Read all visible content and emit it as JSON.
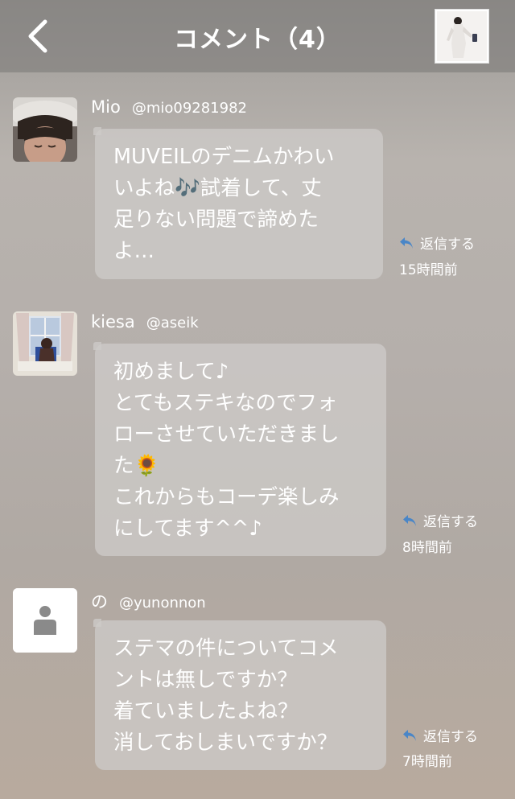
{
  "header": {
    "title": "コメント（4）"
  },
  "comments": [
    {
      "name": "Mio",
      "handle": "@mio09281982",
      "text": "MUVEILのデニムかわい\nいよね🎶試着して、丈\n足りない問題で諦めた\nよ…",
      "reply_label": "返信する",
      "time": "15時間前",
      "avatar_icon": "person-photo-icon"
    },
    {
      "name": "kiesa",
      "handle": "@aseik",
      "text": "初めまして♪\nとてもステキなのでフォ\nローさせていただきまし\nた🌻\nこれからもコーデ楽しみ\nにしてます^^♪",
      "reply_label": "返信する",
      "time": "8時間前",
      "avatar_icon": "window-photo-icon"
    },
    {
      "name": "の",
      "handle": "@yunonnon",
      "text": "ステマの件についてコメ\nントは無しですか？\n着ていましたよね？\n消しておしまいですか？",
      "reply_label": "返信する",
      "time": "7時間前",
      "avatar_icon": "default-user-icon"
    }
  ],
  "colors": {
    "reply_icon": "#4a86c7",
    "bubble": "#cdcac8"
  }
}
